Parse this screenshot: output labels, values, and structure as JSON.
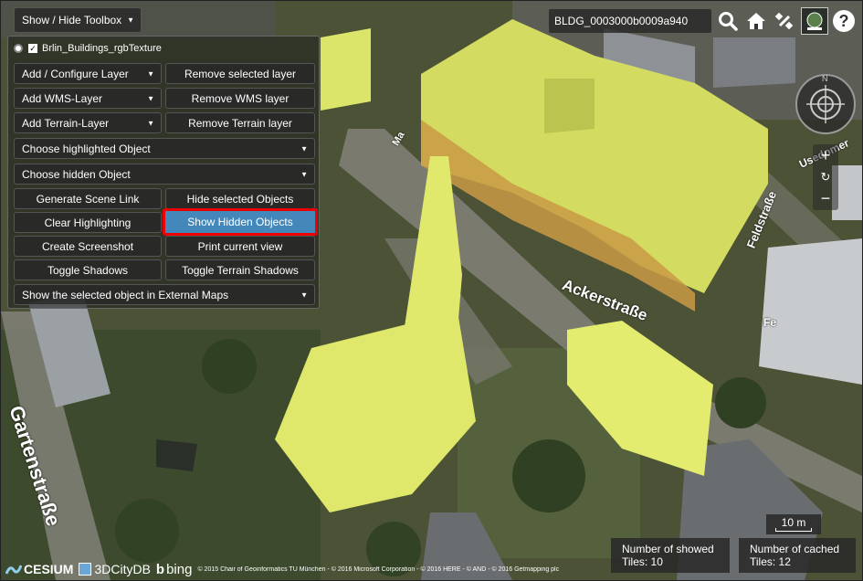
{
  "toolbox": {
    "toggle_label": "Show / Hide Toolbox",
    "layer_name": "Brlin_Buildings_rgbTexture",
    "add_configure_layer": "Add / Configure Layer",
    "remove_selected_layer": "Remove selected layer",
    "add_wms_layer": "Add WMS-Layer",
    "remove_wms_layer": "Remove WMS layer",
    "add_terrain_layer": "Add Terrain-Layer",
    "remove_terrain_layer": "Remove Terrain layer",
    "choose_highlighted": "Choose highlighted Object",
    "choose_hidden": "Choose hidden Object",
    "generate_scene_link": "Generate Scene Link",
    "hide_selected": "Hide selected Objects",
    "clear_highlighting": "Clear Highlighting",
    "show_hidden": "Show Hidden Objects",
    "create_screenshot": "Create Screenshot",
    "print_view": "Print current view",
    "toggle_shadows": "Toggle Shadows",
    "toggle_terrain_shadows": "Toggle Terrain Shadows",
    "external_maps": "Show the selected object in External Maps"
  },
  "header": {
    "selected_object_id": "BLDG_0003000b0009a940",
    "icons": [
      "search-icon",
      "home-icon",
      "satellite-icon",
      "globe-icon",
      "help-icon"
    ],
    "help_glyph": "?",
    "compass_n": "N"
  },
  "navigation": {
    "zoom_in": "+",
    "reset": "↻",
    "zoom_out": "−"
  },
  "map": {
    "streets": [
      "Gartenstraße",
      "Ackerstraße",
      "Feldstraße",
      "Usedomer",
      "Fe",
      "Ma"
    ],
    "scale_label": "10 m"
  },
  "status": {
    "showed_title": "Number of showed",
    "showed_value": "Tiles: 10",
    "cached_title": "Number of cached",
    "cached_value": "Tiles: 12"
  },
  "credits": {
    "cesium": "CESIUM",
    "citydb": "3DCityDB",
    "bing": "bing",
    "text": "© 2015 Chair of Geoinformatics TU München - © 2016 Microsoft Corporation - © 2016 HERE - © AND - © 2016 Getmapping plc"
  },
  "colors": {
    "highlight_yellow": "#e4ee6a",
    "selected_button": "#4a8ec8",
    "selection_border": "#e00000"
  }
}
